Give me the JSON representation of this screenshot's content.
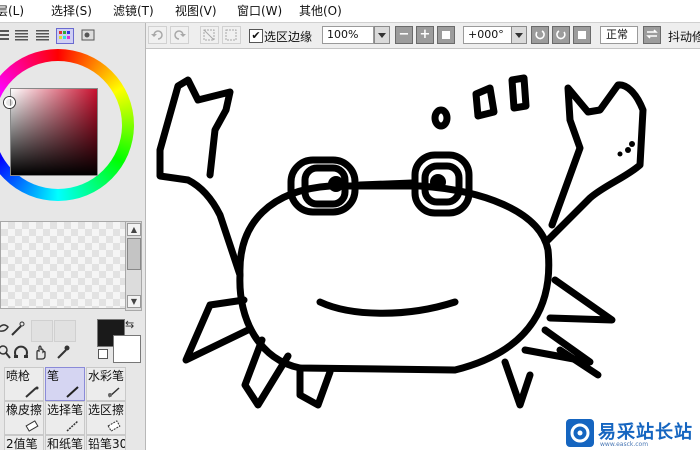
{
  "menubar": {
    "items": [
      "层(L)",
      "选择(S)",
      "滤镜(T)",
      "视图(V)",
      "窗口(W)",
      "其他(O)"
    ]
  },
  "toolbar": {
    "selection_edge_label": "选区边缘",
    "selection_edge_checked": true,
    "zoom": "100%",
    "rotation": "+000°",
    "blend_mode": "正常",
    "stabilizer_label": "抖动修"
  },
  "colors": {
    "main": "#1a1a1a",
    "sub": "#ffffff",
    "accent_hue": "#c8102e"
  },
  "brushes": [
    {
      "label": "喷枪",
      "icon": "airbrush-icon"
    },
    {
      "label": "笔",
      "icon": "pen-icon",
      "selected": true
    },
    {
      "label": "水彩笔",
      "icon": "watercolor-icon"
    },
    {
      "label": "橡皮擦",
      "icon": "eraser-icon"
    },
    {
      "label": "选择笔",
      "icon": "select-pen-icon"
    },
    {
      "label": "选区擦",
      "icon": "select-eraser-icon"
    },
    {
      "label": "2值笔",
      "icon": "binary-pen-icon"
    },
    {
      "label": "和纸笔",
      "icon": "washi-pen-icon"
    },
    {
      "label": "铅笔30",
      "icon": "pencil-icon"
    }
  ],
  "watermark": {
    "text": "易采站长站",
    "sub": "www.easck.com"
  }
}
